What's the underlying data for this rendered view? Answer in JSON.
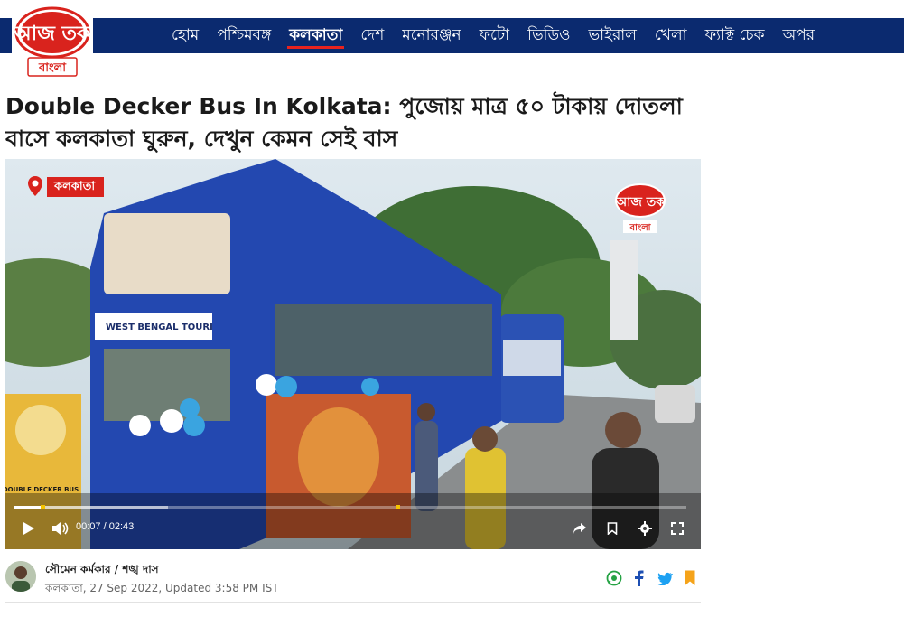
{
  "site": {
    "logo_text_top": "আজ তক",
    "logo_text_bottom": "বাংলা",
    "brand_color": "#d9231d",
    "nav_color": "#0b2a6f"
  },
  "nav": {
    "items": [
      {
        "label": "হোম",
        "active": false
      },
      {
        "label": "পশ্চিমবঙ্গ",
        "active": false
      },
      {
        "label": "কলকাতা",
        "active": true
      },
      {
        "label": "দেশ",
        "active": false
      },
      {
        "label": "মনোরঞ্জন",
        "active": false
      },
      {
        "label": "ফটো",
        "active": false
      },
      {
        "label": "ভিডিও",
        "active": false
      },
      {
        "label": "ভাইরাল",
        "active": false
      },
      {
        "label": "খেলা",
        "active": false
      },
      {
        "label": "ফ্যাক্ট চেক",
        "active": false
      },
      {
        "label": "অপর",
        "active": false
      }
    ]
  },
  "article": {
    "headline": "Double Decker Bus In Kolkata: পুজোয় মাত্র ৫০ টাকায় দোতলা বাসে কলকাতা ঘুরুন, দেখুন কেমন সেই বাস",
    "authors": "সৌমেন কর্মকার / শঙ্খ দাস",
    "meta": "কলকাতা, 27 Sep 2022, Updated 3:58 PM IST"
  },
  "video": {
    "location_badge": "কলকাতা",
    "bus_banner": "WEST BENGAL TOURI",
    "poster_text": "DOUBLE DECKER BUS",
    "watermark_top": "আজ তক",
    "watermark_bottom": "বাংলা",
    "current_time": "00:07",
    "separator": "/",
    "duration": "02:43",
    "progress_fraction": 0.043,
    "buffered_fraction": 0.23,
    "marker_fraction": 0.57
  },
  "share_icons": [
    "whatsapp-icon",
    "facebook-icon",
    "twitter-icon",
    "bookmark-icon"
  ]
}
